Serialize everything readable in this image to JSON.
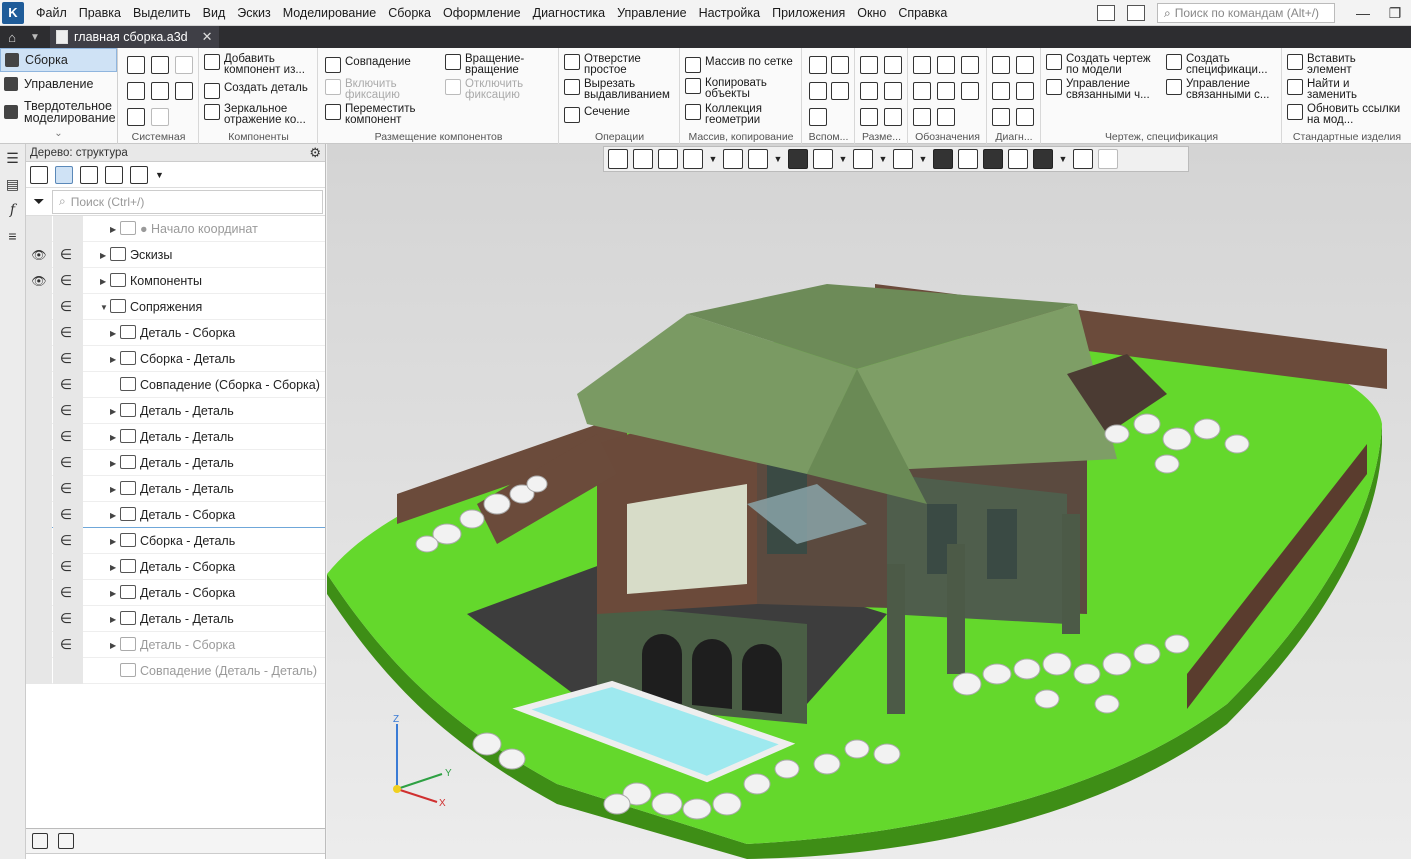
{
  "menu": {
    "items": [
      "Файл",
      "Правка",
      "Выделить",
      "Вид",
      "Эскиз",
      "Моделирование",
      "Сборка",
      "Оформление",
      "Диагностика",
      "Управление",
      "Настройка",
      "Приложения",
      "Окно",
      "Справка"
    ],
    "search_placeholder": "Поиск по командам (Alt+/)"
  },
  "tabs": {
    "document": "главная сборка.a3d"
  },
  "modes": {
    "assembly": "Сборка",
    "control": "Управление",
    "solid": "Твердотельное моделирование"
  },
  "ribbon": {
    "groups": {
      "system": "Системная",
      "components": "Компоненты",
      "placement": "Размещение компонентов",
      "operations": "Операции",
      "array": "Массив, копирование",
      "aux": "Вспом...",
      "dims": "Разме...",
      "marks": "Обозначения",
      "diag": "Диагн...",
      "drawing": "Чертеж, спецификация",
      "std": "Стандартные изделия"
    },
    "buttons": {
      "add_component": "Добавить компонент из...",
      "create_part": "Создать деталь",
      "mirror": "Зеркальное отражение ко...",
      "coincidence": "Совпадение",
      "enable_fix": "Включить фиксацию",
      "move_component": "Переместить компонент",
      "rotation": "Вращение-вращение",
      "disable_fix": "Отключить фиксацию",
      "simple_hole": "Отверстие простое",
      "cut_extrude": "Вырезать выдавливанием",
      "section": "Сечение",
      "grid_array": "Массив по сетке",
      "copy_objects": "Копировать объекты",
      "geom_collection": "Коллекция геометрии",
      "create_drawing": "Создать чертеж по модели",
      "manage_linked": "Управление связанными ч...",
      "create_spec": "Создать спецификаци...",
      "manage_linked_spec": "Управление связанными с...",
      "insert_element": "Вставить элемент",
      "find_replace": "Найти и заменить",
      "update_links": "Обновить ссылки на мод..."
    }
  },
  "tree": {
    "title": "Дерево: структура",
    "search_placeholder": "Поиск (Ctrl+/)",
    "rows": [
      {
        "label": "● Начало координат",
        "dim": true
      },
      {
        "label": "Эскизы"
      },
      {
        "label": "Компоненты"
      },
      {
        "label": "Сопряжения"
      },
      {
        "label": "Деталь - Сборка"
      },
      {
        "label": "Сборка - Деталь"
      },
      {
        "label": "Совпадение (Сборка  -  Сборка)"
      },
      {
        "label": "Деталь - Деталь"
      },
      {
        "label": "Деталь - Деталь"
      },
      {
        "label": "Деталь - Деталь"
      },
      {
        "label": "Деталь - Деталь"
      },
      {
        "label": "Деталь - Сборка"
      },
      {
        "label": "Сборка - Деталь"
      },
      {
        "label": "Деталь - Сборка"
      },
      {
        "label": "Деталь - Сборка"
      },
      {
        "label": "Деталь - Деталь"
      },
      {
        "label": "Деталь - Сборка",
        "dim": true
      },
      {
        "label": "Совпадение (Деталь  -  Деталь)",
        "dim": true
      }
    ]
  },
  "axes": {
    "x": "X",
    "y": "Y",
    "z": "Z"
  },
  "colors": {
    "accent": "#1f5c99",
    "grass": "#5fd32a",
    "roof": "#6f8f5a",
    "wall": "#6a4a3a"
  }
}
